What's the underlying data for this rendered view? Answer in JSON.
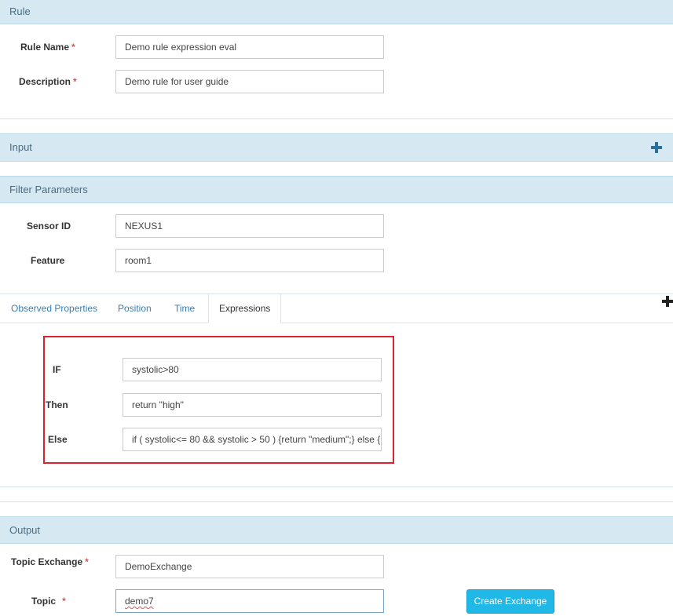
{
  "rule": {
    "header": "Rule",
    "name_label": "Rule Name",
    "name_value": "Demo rule expression eval",
    "description_label": "Description",
    "description_value": "Demo rule for user guide",
    "required_mark": "*"
  },
  "input": {
    "header": "Input"
  },
  "filter": {
    "header": "Filter Parameters",
    "sensor_label": "Sensor ID",
    "sensor_value": "NEXUS1",
    "feature_label": "Feature",
    "feature_value": "room1"
  },
  "tabs": [
    {
      "label": "Observed Properties"
    },
    {
      "label": "Position"
    },
    {
      "label": "Time"
    },
    {
      "label": "Expressions"
    }
  ],
  "expressions": {
    "if_label": "IF",
    "if_value": "systolic>80",
    "then_label": "Then",
    "then_value": "return \"high\"",
    "else_label": "Else",
    "else_value": "if ( systolic<= 80 && systolic > 50 ) {return \"medium\";} else {"
  },
  "output": {
    "header": "Output",
    "exchange_label": "Topic Exchange",
    "exchange_value": "DemoExchange",
    "topic_label": "Topic",
    "topic_value": "demo7",
    "create_button": "Create Exchange"
  },
  "icons": {
    "add_input": "plus-icon",
    "add_tab": "plus-icon"
  },
  "colors": {
    "header_bg": "#d6e9f3",
    "required": "#d9534f",
    "highlight_box": "#d8242c",
    "button": "#20b8e6",
    "tab_link": "#3a7fb3"
  }
}
